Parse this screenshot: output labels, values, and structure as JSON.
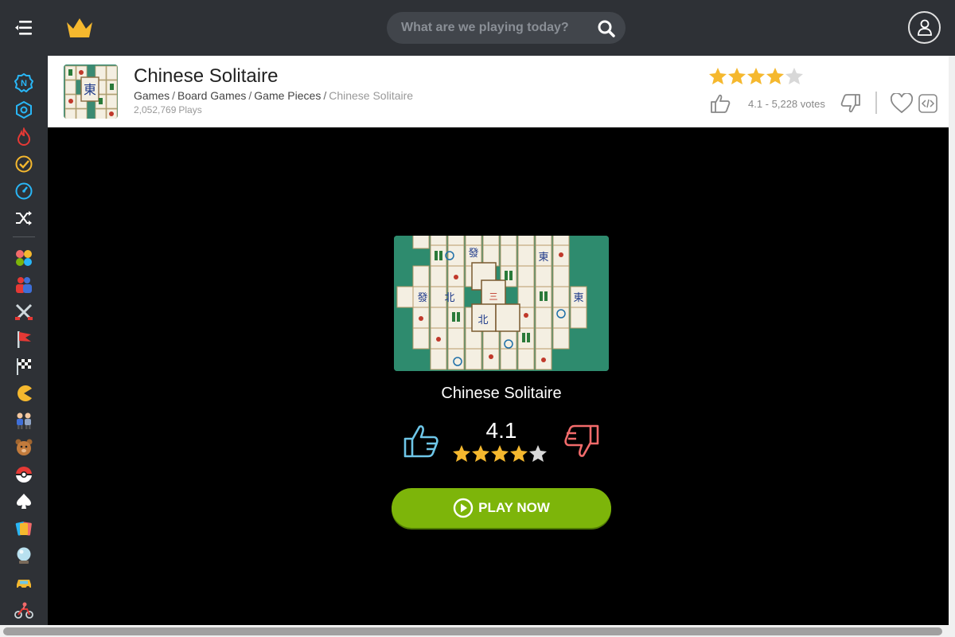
{
  "header": {
    "search_placeholder": "What are we playing today?"
  },
  "game": {
    "title": "Chinese Solitaire",
    "breadcrumbs": [
      "Games",
      "Board Games",
      "Game Pieces",
      "Chinese Solitaire"
    ],
    "plays_count": "2,052,769",
    "plays_label": "Plays",
    "rating": "4.1",
    "votes_text": "4.1 - 5,228 votes",
    "stars": [
      1,
      1,
      1,
      1,
      0
    ]
  },
  "stage": {
    "title": "Chinese Solitaire",
    "rating": "4.1",
    "play_label": "PLAY NOW"
  },
  "sidebar": {
    "items": [
      "new-icon",
      "updated-icon",
      "hot-icon",
      "completed-icon",
      "speed-icon",
      "random-icon",
      "puzzle-icon",
      "two-player-icon",
      "battle-icon",
      "flag-icon",
      "racing-icon",
      "arcade-icon",
      "multiplayer-icon",
      "animal-icon",
      "pokeball-icon",
      "cards-icon",
      "card-games-icon",
      "crystal-ball-icon",
      "car-icon",
      "bike-icon"
    ]
  },
  "colors": {
    "topbar": "#2e3136",
    "accent_star": "#f5b82e",
    "star_empty": "#d8d8d8",
    "play_button": "#7db50a",
    "like_blue": "#6ec6e8",
    "dislike_red": "#f26b6b"
  }
}
